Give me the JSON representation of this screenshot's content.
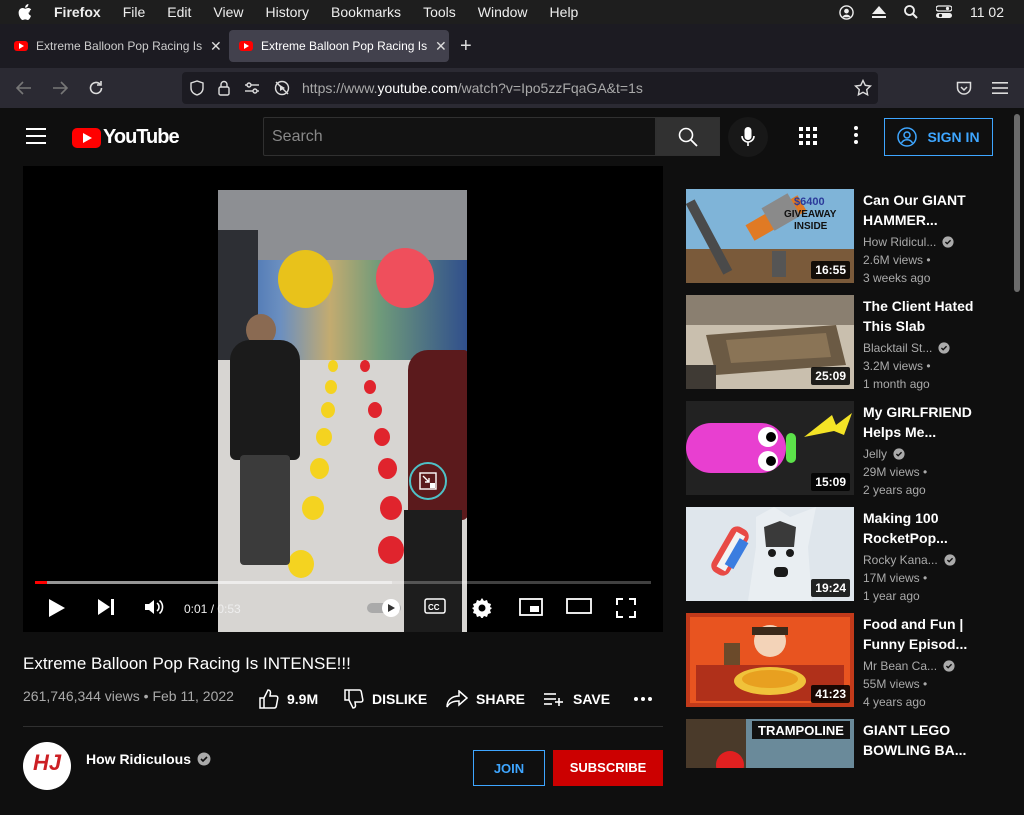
{
  "menubar": {
    "app": "Firefox",
    "items": [
      "File",
      "Edit",
      "View",
      "History",
      "Bookmarks",
      "Tools",
      "Window",
      "Help"
    ],
    "clock": "11 02"
  },
  "tabs": [
    {
      "title": "Extreme Balloon Pop Racing Is INTENSE!!! - YouTube",
      "active": false
    },
    {
      "title": "Extreme Balloon Pop Racing Is INTENSE!!! - YouTube",
      "active": true
    }
  ],
  "navbar": {
    "url_prefix": "https://www.",
    "url_domain": "youtube.com",
    "url_path": "/watch?v=Ipo5zzFqaGA&t=1s"
  },
  "masthead": {
    "logo_text": "YouTube",
    "search_placeholder": "Search",
    "sign_in": "SIGN IN"
  },
  "player": {
    "current_time": "0:01",
    "duration": "0:53",
    "played_fraction": 0.02,
    "buffered_fraction": 0.58,
    "watermark": "HJ"
  },
  "video": {
    "title": "Extreme Balloon Pop Racing Is INTENSE!!!",
    "views": "261,746,344 views",
    "date": "Feb 11, 2022",
    "likes": "9.9M",
    "dislike_label": "DISLIKE",
    "share_label": "SHARE",
    "save_label": "SAVE"
  },
  "channel": {
    "name": "How Ridiculous",
    "join_label": "JOIN",
    "subscribe_label": "SUBSCRIBE"
  },
  "recommendations": [
    {
      "title": "Can Our GIANT HAMMER...",
      "channel": "How Ridicul...",
      "verified": true,
      "views": "2.6M views",
      "age": "3 weeks ago",
      "duration": "16:55",
      "thumb_text_1": "$6400",
      "thumb_text_2": "GIVEAWAY",
      "thumb_text_3": "INSIDE"
    },
    {
      "title": "The Client Hated This Slab",
      "channel": "Blacktail St...",
      "verified": true,
      "views": "3.2M views",
      "age": "1 month ago",
      "duration": "25:09"
    },
    {
      "title": "My GIRLFRIEND Helps Me...",
      "channel": "Jelly",
      "verified": true,
      "views": "29M views",
      "age": "2 years ago",
      "duration": "15:09"
    },
    {
      "title": "Making 100 RocketPop...",
      "channel": "Rocky Kana...",
      "verified": true,
      "views": "17M views",
      "age": "1 year ago",
      "duration": "19:24"
    },
    {
      "title": "Food and Fun | Funny Episod...",
      "channel": "Mr Bean Ca...",
      "verified": true,
      "views": "55M views",
      "age": "4 years ago",
      "duration": "41:23"
    },
    {
      "title": "GIANT LEGO BOWLING BA...",
      "thumb_text_1": "TRAMPOLINE"
    }
  ],
  "colors": {
    "background": "#0f0f0f",
    "accent_blue": "#3ea6ff",
    "youtube_red": "#ff0000",
    "subscribe_red": "#cc0000"
  }
}
